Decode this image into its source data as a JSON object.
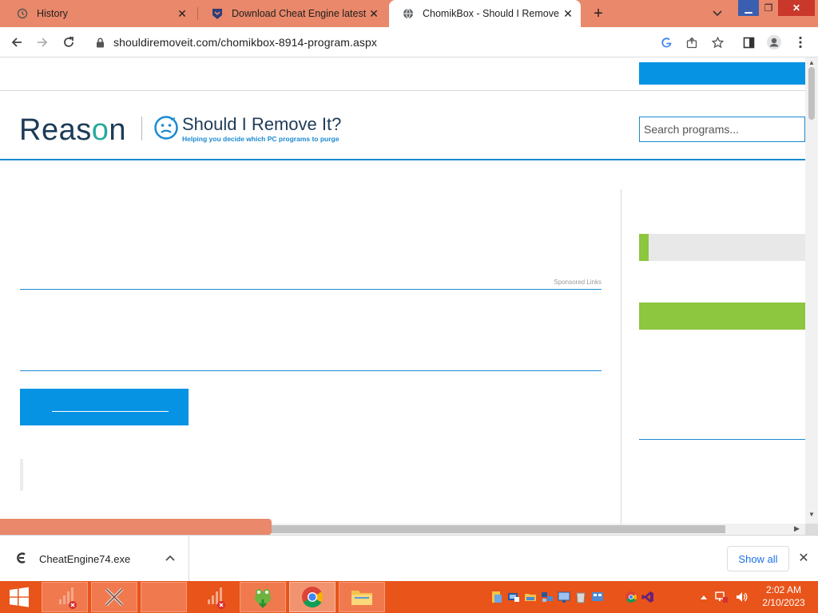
{
  "browser": {
    "tabs": [
      {
        "label": "History",
        "icon": "history-icon",
        "active": false
      },
      {
        "label": "Download Cheat Engine latest ve",
        "icon": "site-shield-icon",
        "active": false
      },
      {
        "label": "ChomikBox - Should I Remove It",
        "icon": "globe-icon",
        "active": true
      }
    ],
    "url": "shouldiremoveit.com/chomikbox-8914-program.aspx"
  },
  "page": {
    "logo_brand": "Reason",
    "logo_title": "Should I Remove It?",
    "logo_tagline": "Helping you decide which PC programs to purge",
    "search_placeholder": "Search programs...",
    "sponsored_label": "Sponsored Links"
  },
  "downloads": {
    "file_name": "CheatEngine74.exe",
    "show_all_label": "Show all"
  },
  "taskbar": {
    "time": "2:02 AM",
    "date": "2/10/2023"
  },
  "colors": {
    "accent_orange": "#e9886a",
    "taskbar": "#e8541a",
    "site_blue": "#0693e3",
    "site_green": "#8dc63f",
    "logo_navy": "#1d3b57"
  }
}
